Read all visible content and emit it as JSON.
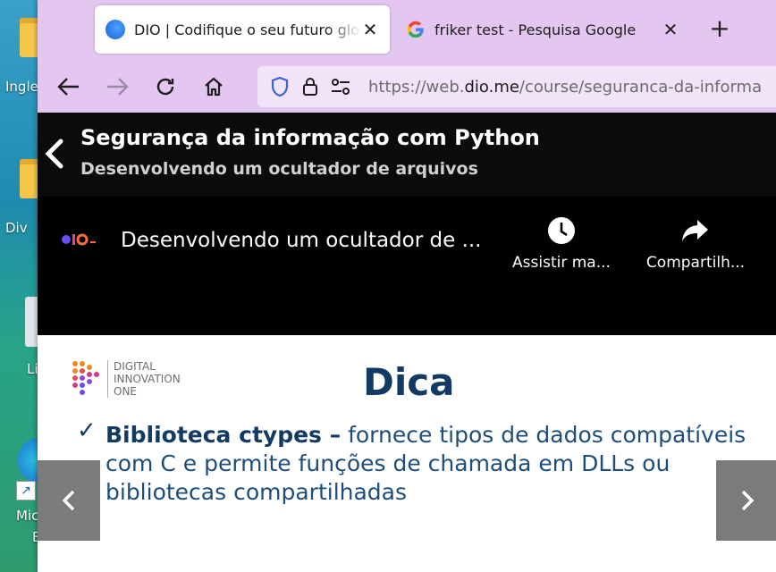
{
  "desktop": {
    "icons": [
      {
        "label": "Ingle"
      },
      {
        "label": "Div"
      },
      {
        "label": "Li"
      },
      {
        "label": "Mic"
      },
      {
        "label": "E"
      }
    ]
  },
  "browser": {
    "tabs": [
      {
        "title": "DIO | Codifique o seu futuro global",
        "icon": "dio-favicon"
      },
      {
        "title": "friker test - Pesquisa Google",
        "icon": "google-favicon"
      }
    ],
    "new_tab_label": "+",
    "url": {
      "prefix": "https://web.",
      "domain": "dio.me",
      "path": "/course/seguranca-da-informa"
    }
  },
  "page": {
    "course_title": "Segurança da informação com Python",
    "course_subtitle": "Desenvolvendo um ocultador de arquivos",
    "video": {
      "title": "Desenvolvendo um ocultador de ...",
      "watch_later_label": "Assistir ma...",
      "share_label": "Compartilh..."
    },
    "slide": {
      "brand_line1": "DIGITAL",
      "brand_line2": "INNOVATION",
      "brand_line3": "ONE",
      "heading": "Dica",
      "bullet_bold": "Biblioteca ctypes –",
      "bullet_text": " fornece tipos de dados compatíveis com C e permite funções de chamada em DLLs ou bibliotecas compartilhadas"
    }
  },
  "colors": {
    "tabstrip": "#e4c7f0",
    "header_bg": "#0b0b0c",
    "slide_heading": "#133a63"
  }
}
